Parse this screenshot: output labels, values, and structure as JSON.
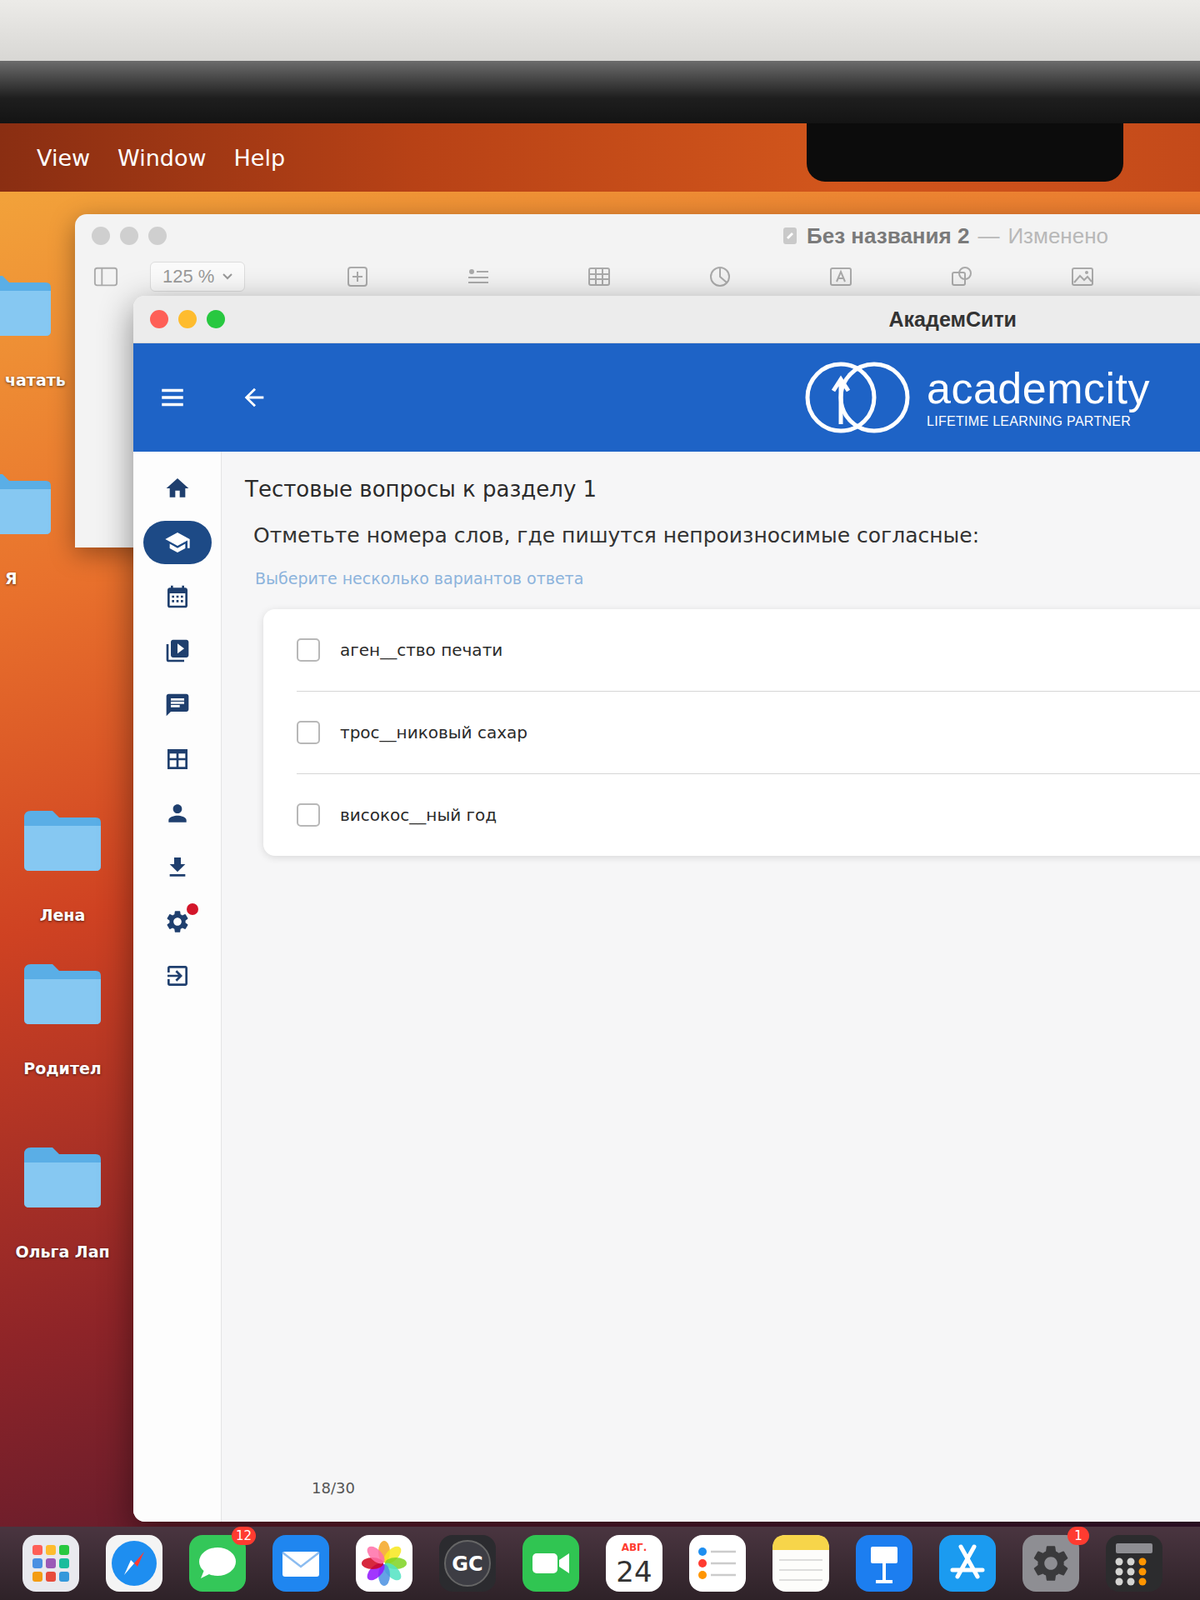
{
  "screen": {
    "menu_bar": [
      "View",
      "Window",
      "Help"
    ]
  },
  "desktop_items": [
    {
      "label": "чатать"
    },
    {
      "label": "Я"
    },
    {
      "label": "Лена"
    },
    {
      "label": "Родител"
    },
    {
      "label": "Ольга Лап"
    }
  ],
  "background_window": {
    "title": "Без названия 2",
    "separator": "—",
    "status": "Изменено",
    "zoom": "125 %"
  },
  "window": {
    "title": "АкадемСити"
  },
  "header": {
    "logo": "academcity",
    "tagline": "LIFETIME LEARNING PARTNER"
  },
  "sidebar": {
    "items": [
      {
        "kind": "home",
        "selected": false,
        "badge": false
      },
      {
        "kind": "courses",
        "selected": true,
        "badge": false
      },
      {
        "kind": "calendar",
        "selected": false,
        "badge": false
      },
      {
        "kind": "video",
        "selected": false,
        "badge": false
      },
      {
        "kind": "chat",
        "selected": false,
        "badge": false
      },
      {
        "kind": "schedule",
        "selected": false,
        "badge": false
      },
      {
        "kind": "profile",
        "selected": false,
        "badge": false
      },
      {
        "kind": "download",
        "selected": false,
        "badge": false
      },
      {
        "kind": "settings",
        "selected": false,
        "badge": true
      },
      {
        "kind": "logout",
        "selected": false,
        "badge": false
      }
    ]
  },
  "quiz": {
    "section": "Тестовые вопросы к разделу 1",
    "question": "Отметьте номера слов, где пишутся непроизносимые согласные:",
    "hint": "Выберите несколько вариантов ответа",
    "options": [
      {
        "text": "аген__ство печати",
        "checked": false
      },
      {
        "text": "трос__никовый сахар",
        "checked": false
      },
      {
        "text": "високос__ный год",
        "checked": false
      }
    ],
    "progress": "18/30"
  },
  "dock": {
    "items": [
      {
        "kind": "launchpad",
        "badge": ""
      },
      {
        "kind": "safari",
        "badge": ""
      },
      {
        "kind": "messages",
        "badge": "12"
      },
      {
        "kind": "mail",
        "badge": ""
      },
      {
        "kind": "photos",
        "badge": ""
      },
      {
        "kind": "gamecenter",
        "badge": "",
        "label": "GC"
      },
      {
        "kind": "facetime",
        "badge": ""
      },
      {
        "kind": "calendar",
        "badge": "",
        "month": "АВГ.",
        "day": "24"
      },
      {
        "kind": "reminders",
        "badge": ""
      },
      {
        "kind": "notes",
        "badge": ""
      },
      {
        "kind": "keynote",
        "badge": ""
      },
      {
        "kind": "appstore",
        "badge": ""
      },
      {
        "kind": "settings",
        "badge": "1"
      },
      {
        "kind": "calculator",
        "badge": ""
      }
    ]
  }
}
